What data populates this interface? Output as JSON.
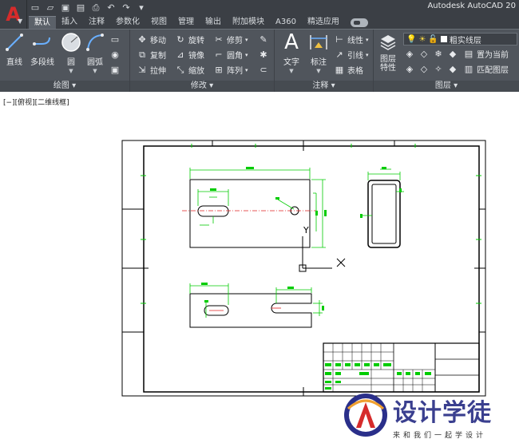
{
  "app": {
    "logo_letter": "A",
    "title": "Autodesk AutoCAD 20"
  },
  "tabs": [
    "默认",
    "插入",
    "注释",
    "参数化",
    "视图",
    "管理",
    "输出",
    "附加模块",
    "A360",
    "精选应用"
  ],
  "ribbon": {
    "draw": {
      "title": "绘图",
      "line": "直线",
      "polyline": "多段线",
      "circle": "圆",
      "arc": "圆弧"
    },
    "modify": {
      "title": "修改",
      "move": "移动",
      "rotate": "旋转",
      "trim": "修剪",
      "copy": "复制",
      "mirror": "镜像",
      "fillet": "圆角",
      "stretch": "拉伸",
      "scale": "缩放",
      "array": "阵列"
    },
    "annotation": {
      "title": "注释",
      "text": "文字",
      "dimension": "标注",
      "linear": "线性",
      "leader": "引线",
      "table": "表格"
    },
    "layers": {
      "title": "图层",
      "properties": "图层\n特性",
      "properties_line1": "图层",
      "properties_line2": "特性",
      "current_layer": "粗实线层",
      "set_current": "置为当前",
      "match_layer": "匹配图层"
    }
  },
  "viewport": {
    "label": "[−][俯视][二维线框]"
  },
  "ucs": {
    "x_label": "X",
    "y_label": "Y"
  },
  "watermark": {
    "title": "设计学徒",
    "subtitle": "来和我们一起学设计"
  },
  "colors": {
    "ribbon_bg": "#50555c",
    "titlebar_bg": "#3b3f45",
    "dimension": "#00cc00",
    "centerline": "#e02020",
    "geometry": "#000000"
  }
}
